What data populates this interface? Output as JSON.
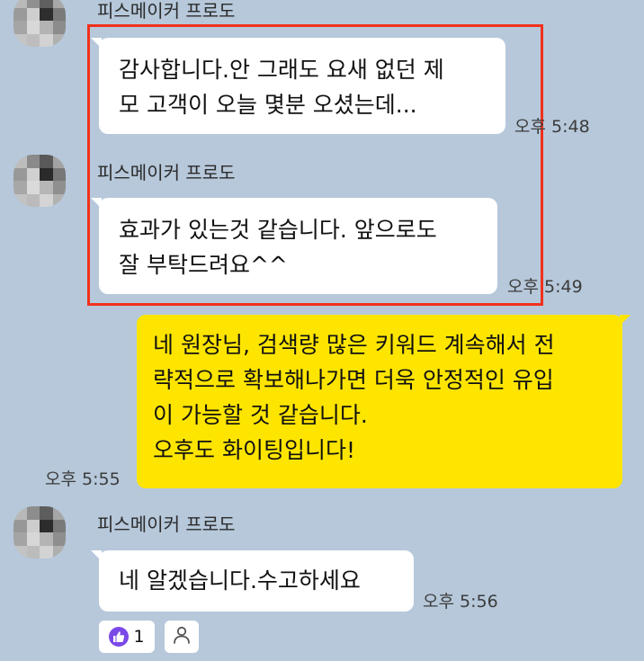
{
  "messages": [
    {
      "sender": "피스메이커 프로도",
      "text": "감사합니다.안 그래도 요새  없던 제\n모 고객이 오늘 몇분 오셨는데...",
      "time": "오후 5:48"
    },
    {
      "sender": "피스메이커 프로도",
      "text": "효과가 있는것 같습니다. 앞으로도\n잘 부탁드려요^^",
      "time": "오후 5:49"
    },
    {
      "sender": "me",
      "text": "네 원장님, 검색량 많은 키워드 계속해서 전\n략적으로 확보해나가면 더욱 안정적인 유입\n이 가능할 것 같습니다.\n오후도 화이팅입니다!",
      "time": "오후 5:55"
    },
    {
      "sender": "피스메이커 프로도",
      "text": "네 알겠습니다.수고하세요",
      "time": "오후 5:56"
    }
  ],
  "reactions": {
    "like_count": "1",
    "like_icon": "thumbs-up-icon",
    "add_icon": "person-icon"
  },
  "colors": {
    "background": "#b6c8da",
    "my_bubble": "#fee500",
    "highlight_border": "#f2301b",
    "like": "#7b49e8"
  }
}
